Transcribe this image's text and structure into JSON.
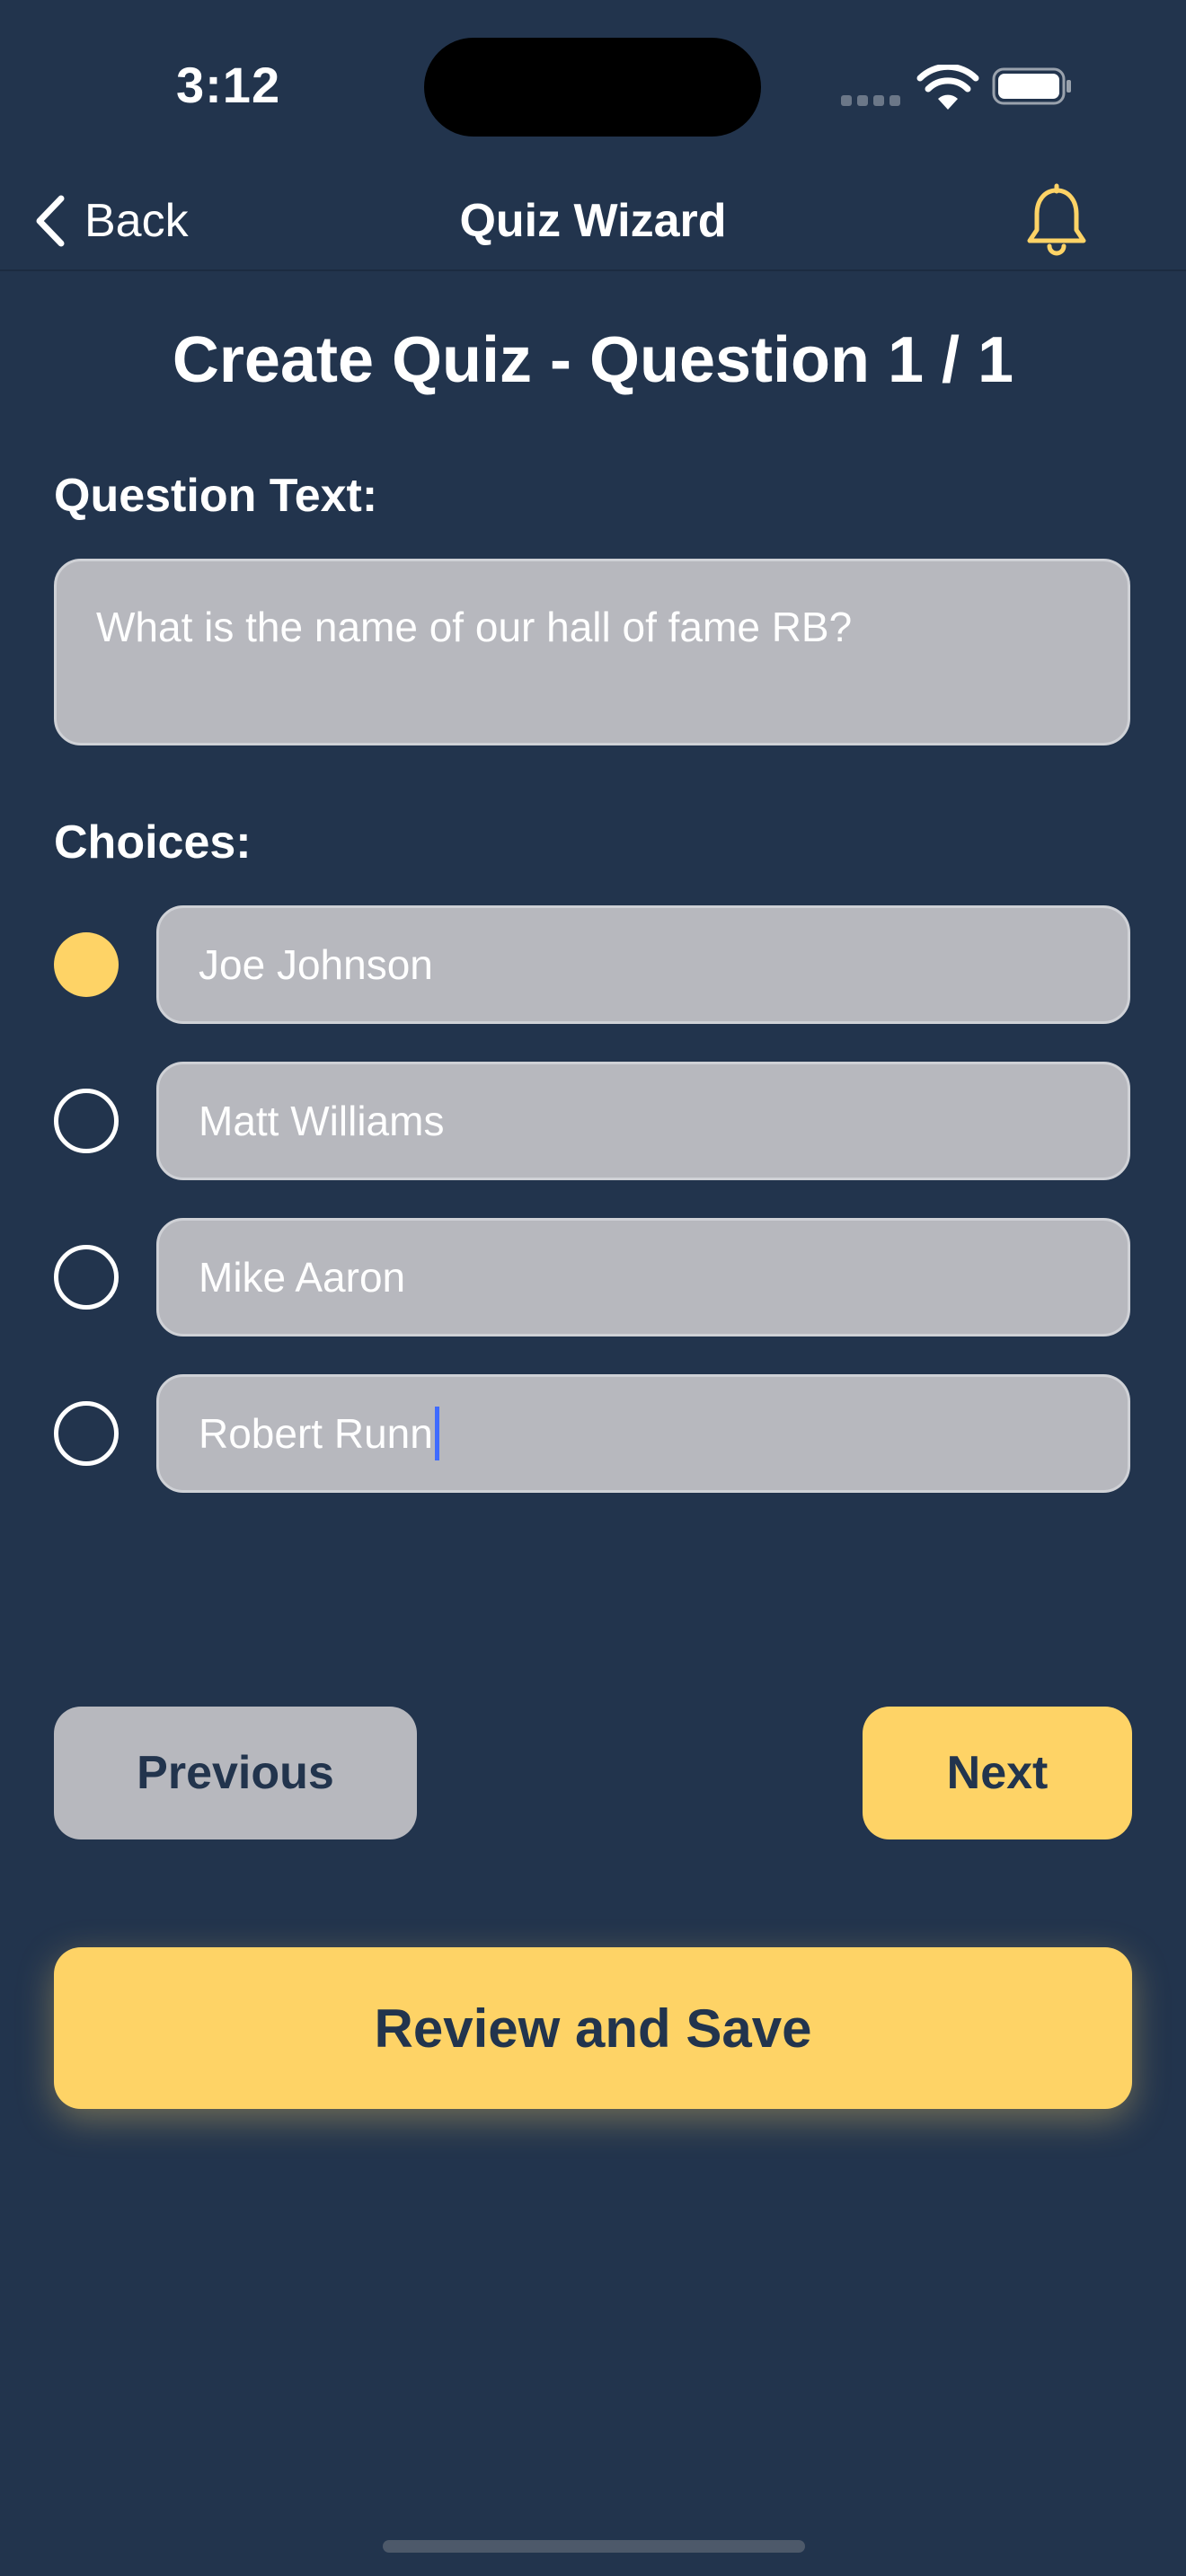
{
  "status_bar": {
    "time": "3:12"
  },
  "nav": {
    "back_label": "Back",
    "title": "Quiz Wizard"
  },
  "page_title": "Create Quiz - Question 1 / 1",
  "question": {
    "label": "Question Text:",
    "value": "What is the name of our hall of fame RB?"
  },
  "choices_label": "Choices:",
  "choices": [
    {
      "value": "Joe Johnson",
      "selected": true
    },
    {
      "value": "Matt Williams",
      "selected": false
    },
    {
      "value": "Mike Aaron",
      "selected": false
    },
    {
      "value": "Robert Runn",
      "selected": false
    }
  ],
  "buttons": {
    "previous": "Previous",
    "next": "Next",
    "review": "Review and Save"
  },
  "colors": {
    "background": "#22344d",
    "accent": "#fed366",
    "field": "#b7b8be",
    "caret": "#3f6bff"
  },
  "icons": [
    "chevron-left-icon",
    "bell-icon",
    "wifi-icon",
    "battery-icon",
    "signal-icon"
  ]
}
